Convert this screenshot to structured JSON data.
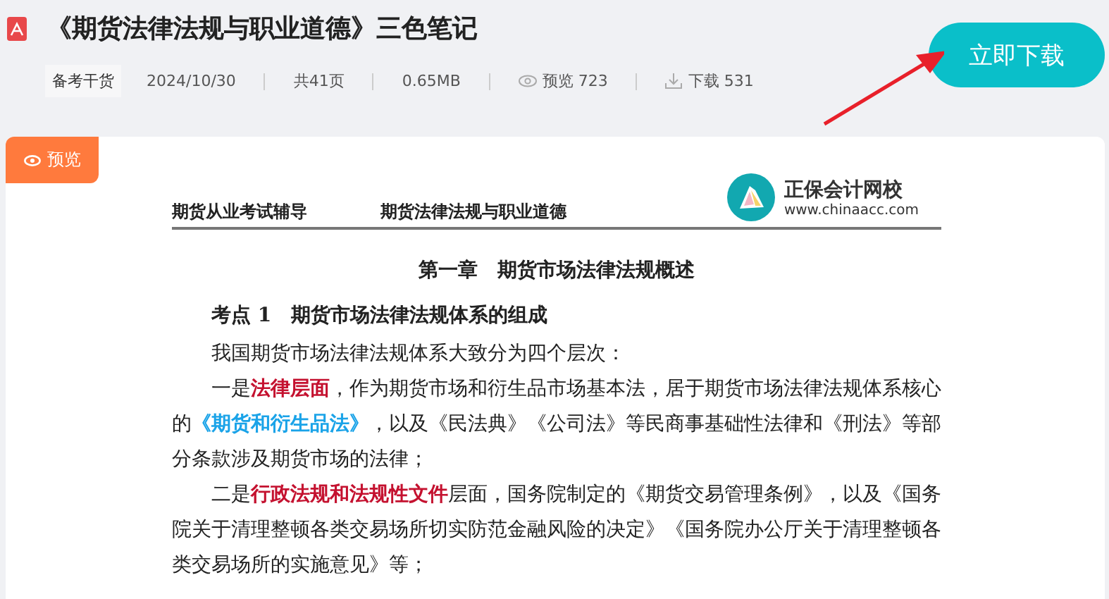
{
  "header": {
    "title": "《期货法律法规与职业道德》三色笔记",
    "meta": {
      "tag": "备考干货",
      "date": "2024/10/30",
      "pages": "共41页",
      "size": "0.65MB",
      "views": "预览 723",
      "downloads": "下载 531"
    },
    "download_button": "立即下载"
  },
  "preview": {
    "tab": "预览",
    "document": {
      "running_head": [
        "期货从业考试辅导",
        "期货法律法规与职业道德"
      ],
      "logo": {
        "name": "正保会计网校",
        "url": "www.chinaacc.com"
      },
      "chapter": "第一章　期货市场法律法规概述",
      "section": "考点 1　期货市场法律法规体系的组成",
      "paragraphs": [
        [
          {
            "kind": "plain",
            "text": "我国期货市场法律法规体系大致分为四个层次："
          }
        ],
        [
          {
            "kind": "plain",
            "text": "一是"
          },
          {
            "kind": "key",
            "text": "法律层面"
          },
          {
            "kind": "plain",
            "text": "，作为期货市场和衍生品市场基本法，居于期货市场法律法规体系核心的"
          },
          {
            "kind": "ref",
            "text": "《期货和衍生品法》"
          },
          {
            "kind": "plain",
            "text": "，以及《民法典》《公司法》等民商事基础性法律和《刑法》等部分条款涉及期货市场的法律；"
          }
        ],
        [
          {
            "kind": "plain",
            "text": "二是"
          },
          {
            "kind": "key",
            "text": "行政法规和法规性文件"
          },
          {
            "kind": "plain",
            "text": "层面，国务院制定的《期货交易管理条例》，以及《国务院关于清理整顿各类交易场所切实防范金融风险的决定》《国务院办公厅关于清理整顿各类交易场所的实施意见》等；"
          }
        ]
      ]
    }
  }
}
